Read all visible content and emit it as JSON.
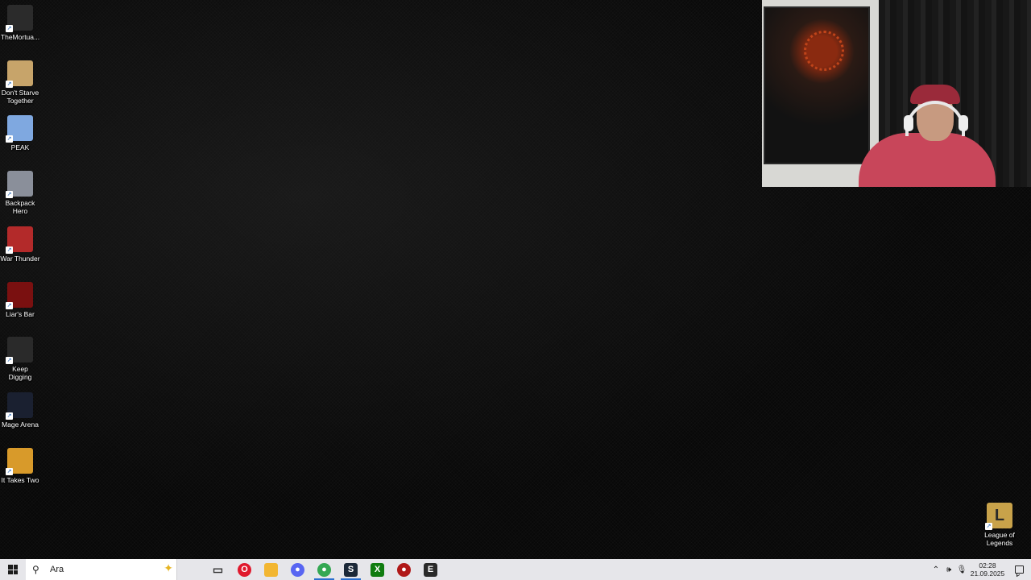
{
  "desktop_icons": [
    {
      "label": "TheMortua...",
      "icon": "the-mortuary-assistant-icon",
      "color": "#2b2b2b"
    },
    {
      "label": "Don't Starve Together",
      "icon": "dont-starve-together-icon",
      "color": "#c7a46a"
    },
    {
      "label": "PEAK",
      "icon": "peak-icon",
      "color": "#7fa8e0"
    },
    {
      "label": "Backpack Hero",
      "icon": "backpack-hero-icon",
      "color": "#8a8f9a"
    },
    {
      "label": "War Thunder",
      "icon": "war-thunder-icon",
      "color": "#b32a2a"
    },
    {
      "label": "Liar's Bar",
      "icon": "liars-bar-icon",
      "color": "#7a1010"
    },
    {
      "label": "Keep Digging",
      "icon": "keep-digging-icon",
      "color": "#2a2a2a"
    },
    {
      "label": "Mage Arena",
      "icon": "mage-arena-icon",
      "color": "#1a2030"
    },
    {
      "label": "It Takes Two",
      "icon": "it-takes-two-icon",
      "color": "#d89a2a"
    }
  ],
  "corner_icon": {
    "label": "League of Legends",
    "icon": "league-of-legends-icon",
    "color": "#c8a24a"
  },
  "taskbar": {
    "search_placeholder": "Ara",
    "apps": [
      {
        "name": "task-view",
        "icon": "task-view-icon",
        "glyph": "▭",
        "color": "#333333"
      },
      {
        "name": "opera",
        "icon": "opera-icon",
        "glyph": "O",
        "color": "#e0192d"
      },
      {
        "name": "file-explorer",
        "icon": "folder-icon",
        "glyph": "",
        "color": "#f2b632"
      },
      {
        "name": "discord",
        "icon": "discord-icon",
        "glyph": "●",
        "color": "#5865f2"
      },
      {
        "name": "chrome",
        "icon": "chrome-icon",
        "glyph": "●",
        "color": "#34a853"
      },
      {
        "name": "steam",
        "icon": "steam-icon",
        "glyph": "S",
        "color": "#1b2838"
      },
      {
        "name": "xbox",
        "icon": "xbox-icon",
        "glyph": "X",
        "color": "#107c10"
      },
      {
        "name": "app-red-black",
        "icon": "game-launcher-icon",
        "glyph": "●",
        "color": "#b01818"
      },
      {
        "name": "epic-games",
        "icon": "epic-games-icon",
        "glyph": "E",
        "color": "#2a2a2a"
      }
    ],
    "clock_time": "02:28",
    "clock_date": "21.09.2025"
  }
}
